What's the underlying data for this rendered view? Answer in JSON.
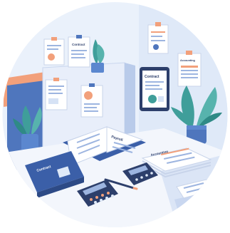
{
  "labels": {
    "contract_wall": "Contract",
    "contract_tablet": "Contract",
    "accounting_wall": "Accounting",
    "payroll": "Payroll",
    "contract_binder": "Contract",
    "accounting_ledger": "Accounting"
  },
  "colors": {
    "circle_bg": "#eaf1fb",
    "wall_light": "#dfe9f8",
    "partition_blue": "#4f76bd",
    "partition_light": "#e8eefa",
    "accent_orange": "#f2a07b",
    "desk_top": "#f3f6fc",
    "desk_front": "#9db5e0",
    "binder_blue": "#3b5fa8",
    "calculator_dark": "#2d3f6b",
    "plant_green": "#3f9e9a",
    "pot_blue": "#5b87cf"
  },
  "icons": [
    "potted-plant-icon",
    "calculator-icon",
    "pen-icon",
    "binder-icon",
    "tablet-icon",
    "clipboard-icon"
  ]
}
